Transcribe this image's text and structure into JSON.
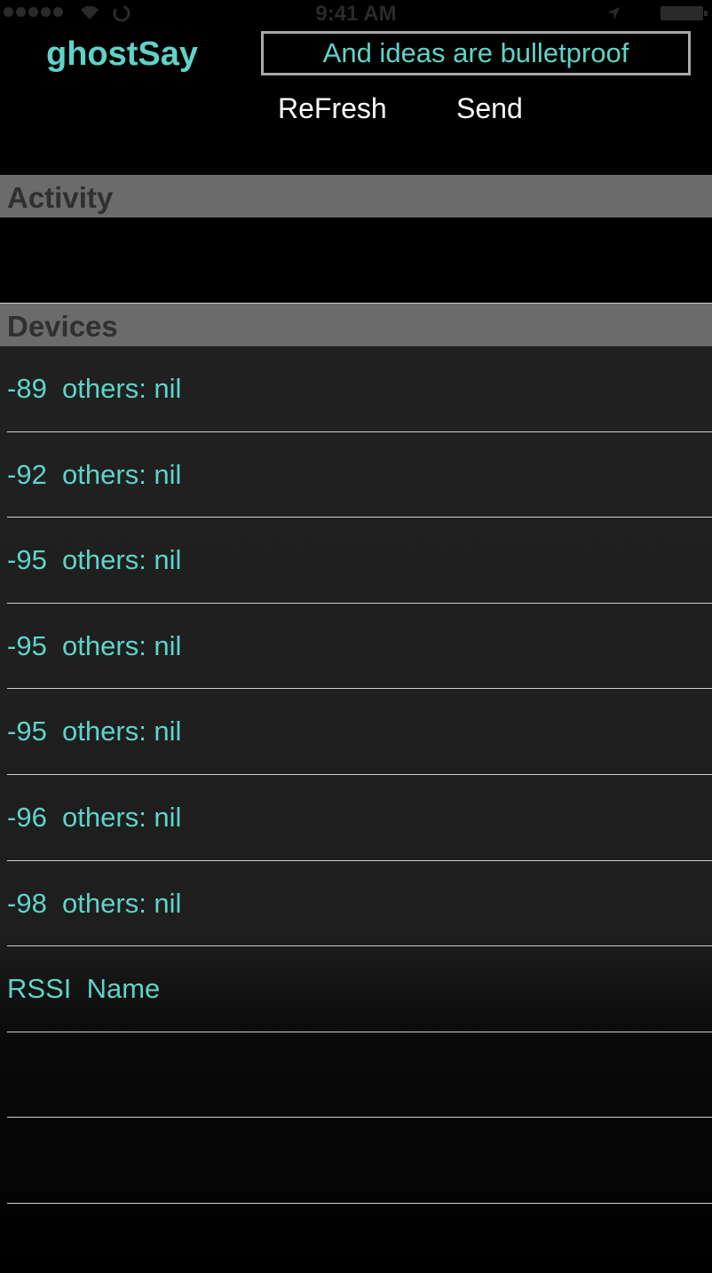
{
  "status_bar": {
    "time": "9:41 AM"
  },
  "header": {
    "title": "ghostSay",
    "message_value": "And ideas are bulletproof",
    "refresh_label": "ReFresh",
    "send_label": "Send"
  },
  "sections": {
    "activity": "Activity",
    "devices": "Devices"
  },
  "devices": [
    {
      "rssi": "-89",
      "name": "others: nil"
    },
    {
      "rssi": "-92",
      "name": "others: nil"
    },
    {
      "rssi": "-95",
      "name": "others: nil"
    },
    {
      "rssi": "-95",
      "name": "others: nil"
    },
    {
      "rssi": "-95",
      "name": "others: nil"
    },
    {
      "rssi": "-96",
      "name": "others: nil"
    },
    {
      "rssi": "-98",
      "name": "others: nil"
    },
    {
      "rssi": "RSSI",
      "name": "Name"
    },
    {
      "rssi": "",
      "name": ""
    },
    {
      "rssi": "",
      "name": ""
    },
    {
      "rssi": "",
      "name": ""
    }
  ],
  "colors": {
    "accent": "#5fd3c8",
    "section_header_bg": "#6b6b6b",
    "separator": "#cfcfcf"
  },
  "icons": [
    "signal-icon",
    "wifi-icon",
    "activity-spinner-icon",
    "location-arrow-icon",
    "battery-icon"
  ]
}
